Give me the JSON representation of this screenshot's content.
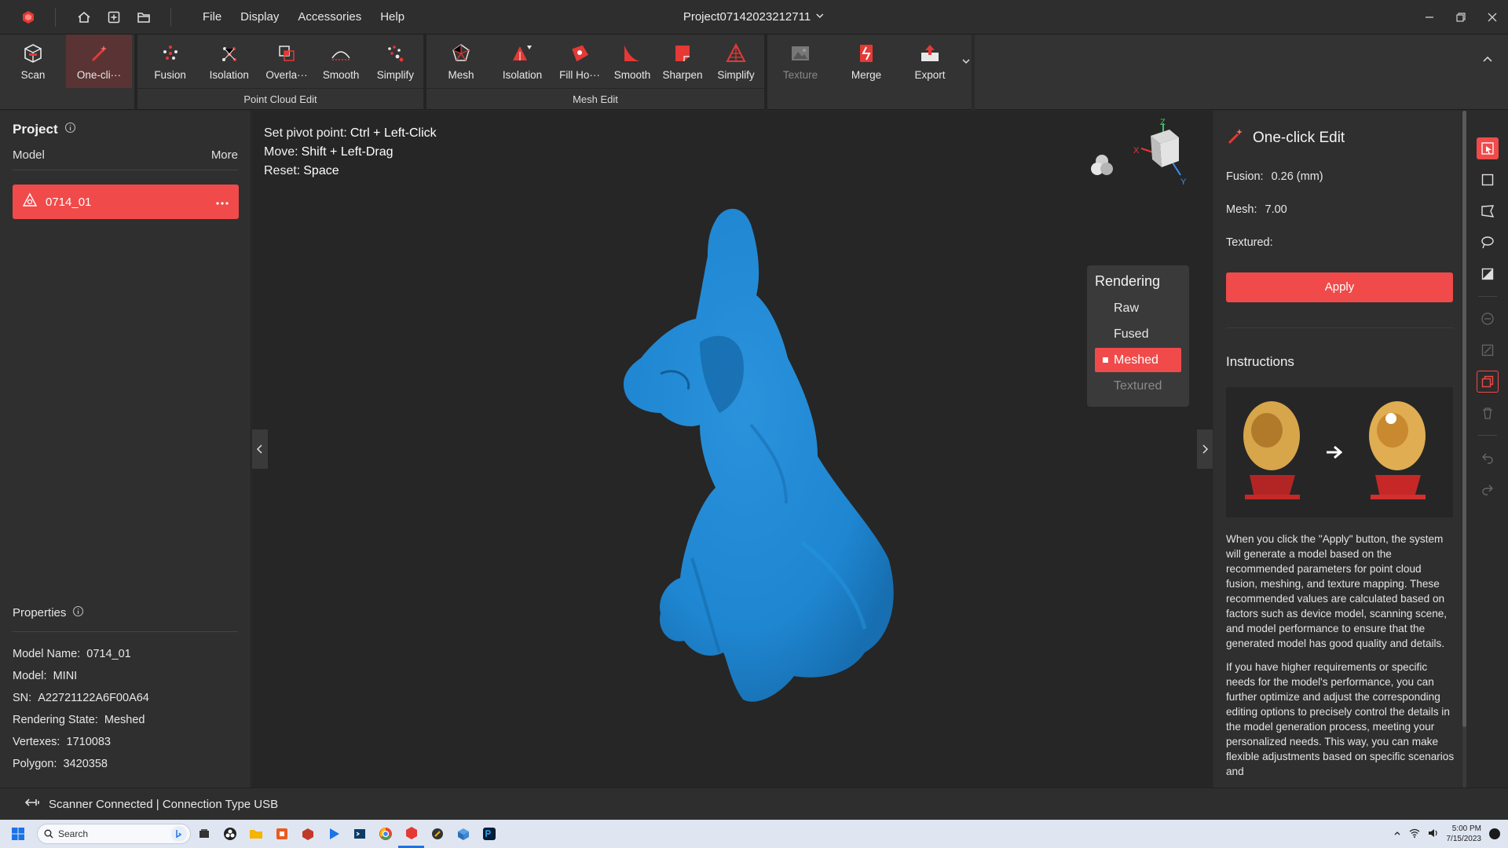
{
  "titlebar": {
    "menu": [
      "File",
      "Display",
      "Accessories",
      "Help"
    ],
    "project_title": "Project07142023212711"
  },
  "ribbon": {
    "group1": {
      "tools": [
        {
          "label": "Scan",
          "icon": "scan-icon"
        },
        {
          "label": "One-cli···",
          "icon": "magic-wand-icon"
        }
      ]
    },
    "group2": {
      "label": "Point Cloud Edit",
      "tools": [
        {
          "label": "Fusion",
          "icon": "fusion-icon"
        },
        {
          "label": "Isolation",
          "icon": "isolation-icon"
        },
        {
          "label": "Overla···",
          "icon": "overlap-icon"
        },
        {
          "label": "Smooth",
          "icon": "smooth-icon"
        },
        {
          "label": "Simplify",
          "icon": "simplify-icon"
        }
      ]
    },
    "group3": {
      "label": "Mesh Edit",
      "tools": [
        {
          "label": "Mesh",
          "icon": "mesh-icon"
        },
        {
          "label": "Isolation",
          "icon": "isolation-icon"
        },
        {
          "label": "Fill Ho···",
          "icon": "fill-holes-icon"
        },
        {
          "label": "Smooth",
          "icon": "smooth-icon"
        },
        {
          "label": "Sharpen",
          "icon": "sharpen-icon"
        },
        {
          "label": "Simplify",
          "icon": "simplify-icon"
        }
      ]
    },
    "group4": {
      "tools": [
        {
          "label": "Texture",
          "icon": "texture-icon"
        },
        {
          "label": "Merge",
          "icon": "merge-icon"
        },
        {
          "label": "Export",
          "icon": "export-icon"
        }
      ]
    }
  },
  "left": {
    "project_label": "Project",
    "model_label": "Model",
    "more_label": "More",
    "model_item": "0714_01",
    "properties_label": "Properties",
    "props": [
      {
        "k": "Model Name:",
        "v": "0714_01"
      },
      {
        "k": "Model:",
        "v": "MINI"
      },
      {
        "k": "SN:",
        "v": "A22721122A6F00A64"
      },
      {
        "k": "Rendering State:",
        "v": "Meshed"
      },
      {
        "k": "Vertexes:",
        "v": "1710083"
      },
      {
        "k": "Polygon:",
        "v": "3420358"
      }
    ]
  },
  "viewport": {
    "hints": [
      {
        "k": "Set pivot point:",
        "v": "Ctrl + Left-Click"
      },
      {
        "k": "Move:",
        "v": "Shift + Left-Drag"
      },
      {
        "k": "Reset:",
        "v": "Space"
      }
    ],
    "rendering_title": "Rendering",
    "rendering_options": [
      "Raw",
      "Fused",
      "Meshed",
      "Textured"
    ],
    "rendering_selected": "Meshed",
    "model_color": "#1f86d1",
    "axes": {
      "z": "Z",
      "x": "X",
      "y": "Y"
    }
  },
  "right": {
    "title": "One-click Edit",
    "fusion_label": "Fusion:",
    "fusion_value": "0.26 (mm)",
    "mesh_label": "Mesh:",
    "mesh_value": "7.00",
    "textured_label": "Textured:",
    "apply_label": "Apply",
    "instructions_title": "Instructions",
    "instructions_p1": "When you click the \"Apply\" button, the system will generate a model based on the recommended parameters for point cloud fusion, meshing, and texture mapping. These recommended values are calculated based on factors such as device model, scanning scene, and model performance to ensure that the generated model has good quality and details.",
    "instructions_p2": "If you have higher requirements or specific needs for the model's performance, you can further optimize and adjust the corresponding editing options to precisely control the details in the model generation process, meeting your personalized needs. This way, you can make flexible adjustments based on specific scenarios and"
  },
  "status": {
    "text": "Scanner Connected | Connection Type USB"
  },
  "taskbar": {
    "search_placeholder": "Search",
    "time": "5:00 PM",
    "date": "7/15/2023"
  },
  "colors": {
    "accent": "#f04a4a",
    "model": "#1f86d1"
  }
}
